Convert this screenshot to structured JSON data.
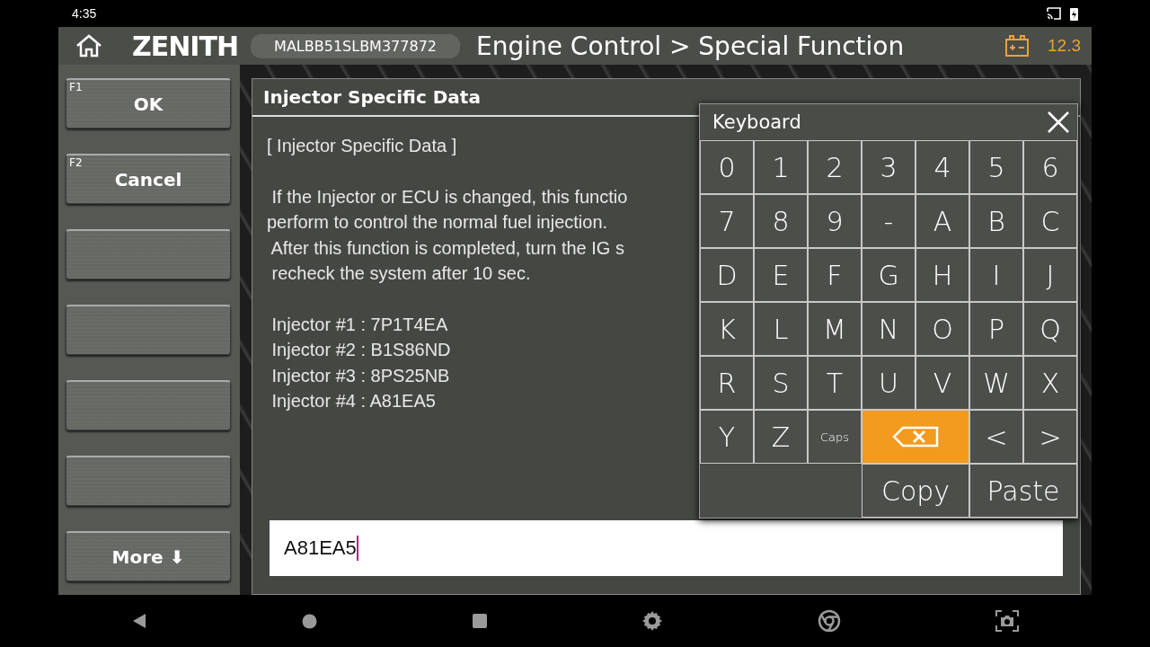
{
  "status_bar": {
    "time": "4:35"
  },
  "header": {
    "brand": "ZENITH",
    "vin": "MALBB51SLBM377872",
    "title": "Engine Control > Special Function",
    "battery_voltage": "12.3"
  },
  "function_keys": [
    {
      "kind": "labeled",
      "key": "F1",
      "label": "OK"
    },
    {
      "kind": "labeled",
      "key": "F2",
      "label": "Cancel"
    },
    {
      "kind": "empty"
    },
    {
      "kind": "empty"
    },
    {
      "kind": "empty"
    },
    {
      "kind": "empty"
    },
    {
      "kind": "labeled",
      "label": "More ⬇"
    }
  ],
  "panel": {
    "title": "Injector Specific Data",
    "heading": "[ Injector Specific Data ]",
    "lines": [
      " If the Injector or ECU is changed, this functio",
      "perform to control the normal fuel injection.",
      " After this function is completed, turn the IG s",
      " recheck the system after 10 sec."
    ],
    "injectors": [
      "Injector #1 : 7P1T4EA",
      "Injector #2 : B1S86ND",
      "Injector #3 : 8PS25NB",
      "Injector #4 : A81EA5"
    ],
    "input": {
      "value": "A81EA5"
    }
  },
  "keyboard": {
    "title": "Keyboard",
    "keys": [
      {
        "kind": "char",
        "label": "0"
      },
      {
        "kind": "char",
        "label": "1"
      },
      {
        "kind": "char",
        "label": "2"
      },
      {
        "kind": "char",
        "label": "3"
      },
      {
        "kind": "char",
        "label": "4"
      },
      {
        "kind": "char",
        "label": "5"
      },
      {
        "kind": "char",
        "label": "6"
      },
      {
        "kind": "char",
        "label": "7"
      },
      {
        "kind": "char",
        "label": "8"
      },
      {
        "kind": "char",
        "label": "9"
      },
      {
        "kind": "char",
        "label": "-"
      },
      {
        "kind": "char",
        "label": "A"
      },
      {
        "kind": "char",
        "label": "B"
      },
      {
        "kind": "char",
        "label": "C"
      },
      {
        "kind": "char",
        "label": "D"
      },
      {
        "kind": "char",
        "label": "E"
      },
      {
        "kind": "char",
        "label": "F"
      },
      {
        "kind": "char",
        "label": "G"
      },
      {
        "kind": "char",
        "label": "H"
      },
      {
        "kind": "char",
        "label": "I"
      },
      {
        "kind": "char",
        "label": "J"
      },
      {
        "kind": "char",
        "label": "K"
      },
      {
        "kind": "char",
        "label": "L"
      },
      {
        "kind": "char",
        "label": "M"
      },
      {
        "kind": "char",
        "label": "N"
      },
      {
        "kind": "char",
        "label": "O"
      },
      {
        "kind": "char",
        "label": "P"
      },
      {
        "kind": "char",
        "label": "Q"
      },
      {
        "kind": "char",
        "label": "R"
      },
      {
        "kind": "char",
        "label": "S"
      },
      {
        "kind": "char",
        "label": "T"
      },
      {
        "kind": "char",
        "label": "U"
      },
      {
        "kind": "char",
        "label": "V"
      },
      {
        "kind": "char",
        "label": "W"
      },
      {
        "kind": "char",
        "label": "X"
      },
      {
        "kind": "char",
        "label": "Y"
      },
      {
        "kind": "char",
        "label": "Z"
      },
      {
        "kind": "small",
        "label": "Caps"
      },
      {
        "kind": "backspace"
      },
      {
        "kind": "char",
        "label": "<"
      },
      {
        "kind": "char",
        "label": ">"
      },
      {
        "kind": "blank"
      },
      {
        "kind": "wide",
        "label": "Copy"
      },
      {
        "kind": "wide",
        "label": "Paste"
      }
    ]
  }
}
